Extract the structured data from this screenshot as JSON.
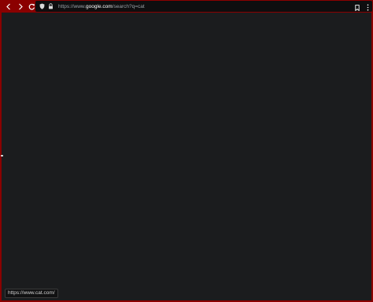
{
  "toolbar": {
    "back_icon": "chevron-left-icon",
    "forward_icon": "chevron-right-icon",
    "reload_icon": "reload-icon"
  },
  "urlbar": {
    "prefix": "https://www.",
    "domain": "google.com",
    "suffix": "/search?q=cat",
    "shield_icon": "shield-icon",
    "lock_icon": "lock-icon"
  },
  "toolbar_right": {
    "bookmark_icon": "bookmark-icon",
    "menu_icon": "kebab-menu-icon"
  },
  "status_bar": {
    "link_url": "https://www.cat.com/"
  },
  "colors": {
    "frame": "#8b0000",
    "background": "#1b1c1e",
    "urlbar": "#0e0e0f"
  }
}
